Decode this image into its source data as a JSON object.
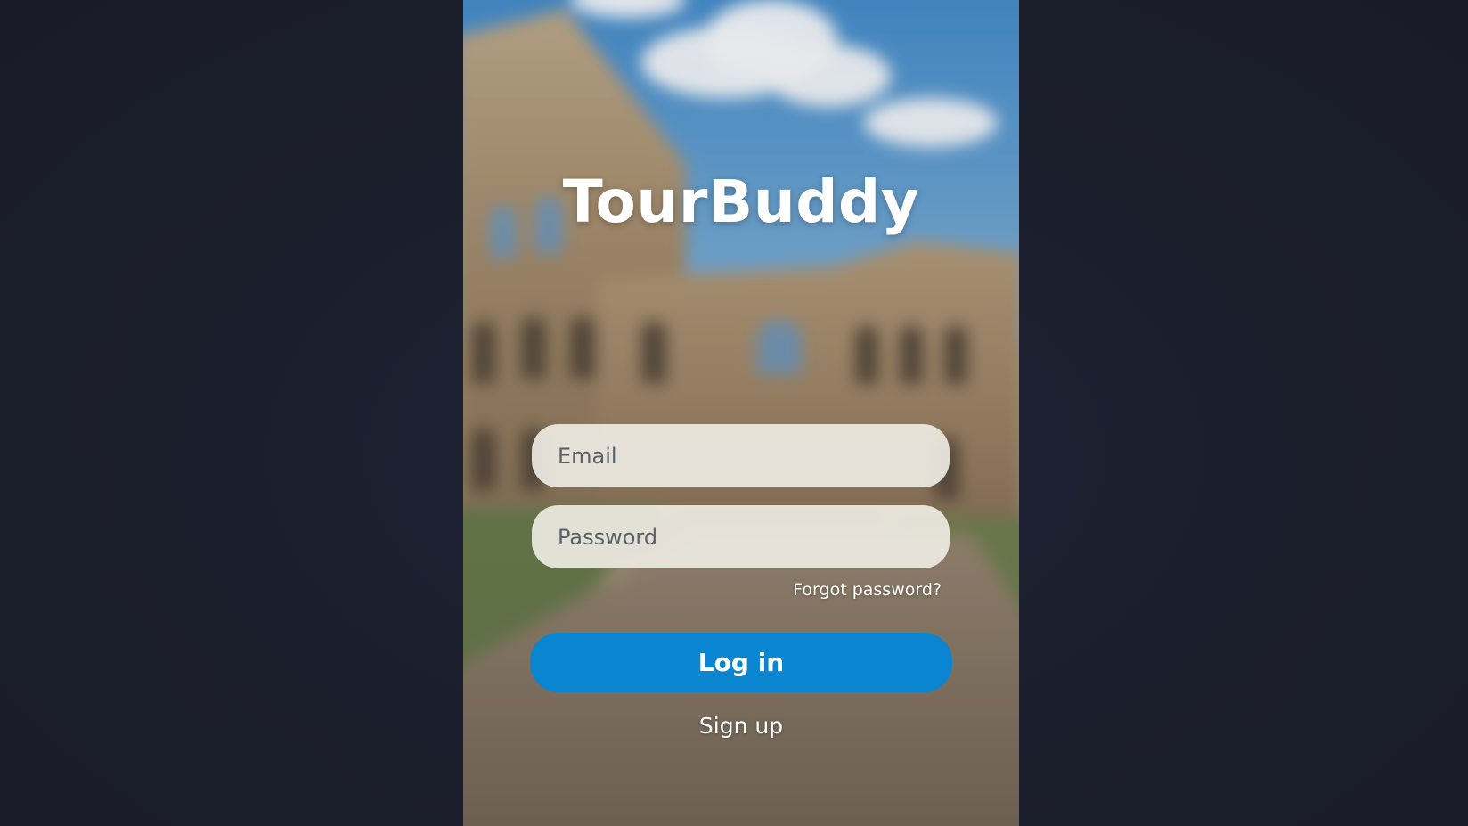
{
  "app": {
    "title": "TourBuddy"
  },
  "login_form": {
    "email_placeholder": "Email",
    "email_value": "",
    "password_placeholder": "Password",
    "password_value": "",
    "forgot_password_label": "Forgot password?",
    "login_label": "Log in",
    "signup_label": "Sign up"
  },
  "colors": {
    "outer_background": "#1b1e2b",
    "primary_button": "#0a86d0",
    "input_background": "#f0ede6",
    "title_text": "#ffffff"
  }
}
